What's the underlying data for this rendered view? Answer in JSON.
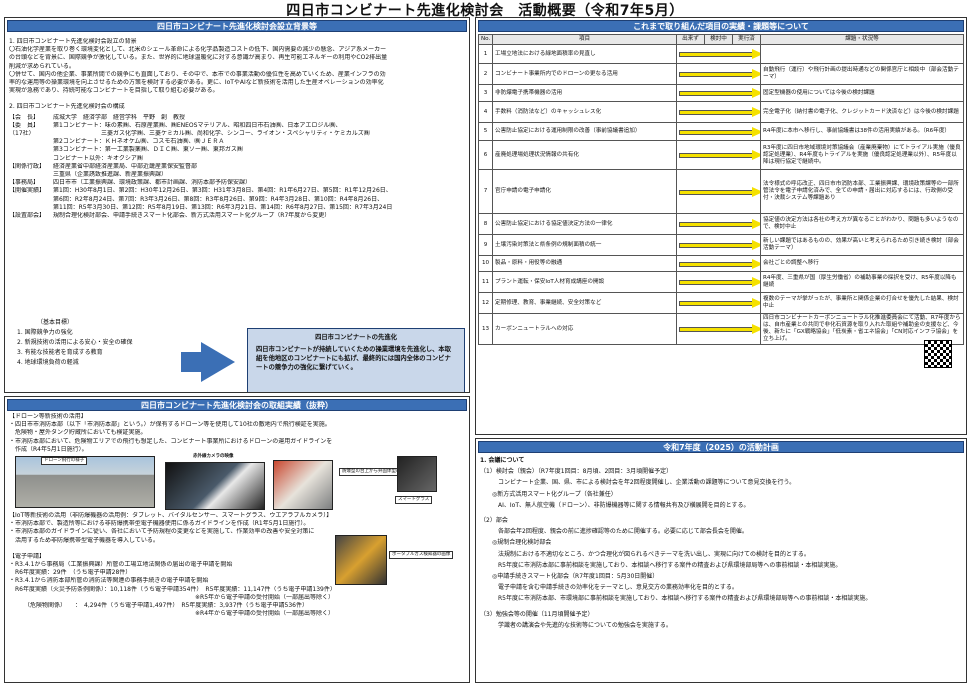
{
  "title": "四日市コンビナート先進化検討会　活動概要（令和7年5月）",
  "background": {
    "header": "四日市コンビナート先進化検討会設立背景等",
    "sec1_title": "1. 四日市コンビナート先進化検討会設立の背景",
    "sec1_lines": [
      "〇石油化学産業を取り巻く環境変化として、北米のシェール革命による化学品製造コストの低下、国内需要の減少の懸念、アジア系メーカー",
      "の台頭などを背景に、国際競争が激化している。また、世界的に地球温暖化に対する意識が高まり、再生可能エネルギーの利用やCO2排出量",
      "削減が求められている。",
      "〇併せて、国内の他企業、事業所間での競争にも直面しており、その中で、本市での事業活動の優位性を高めていくため、産業インフラの効",
      "率的な運用等の操業環境を向上させるための方策を検討する必要がある。更に、IoTやAIなど新技術を活用した生産オペレーションの効率化",
      "実現が急務であり、持続可能なコンビナートを目指して取り組む必要がある。"
    ],
    "sec2_title": "2. 四日市コンビナート先進化検討会の構成",
    "members": [
      {
        "k": "【会　長】",
        "v": "成城大学　経済学部　経営学科　平野　創　教授"
      },
      {
        "k": "【委　員】",
        "v": "第1コンビナート：味の素㈱、石原産業㈱、㈱ENEOSマテリアル、昭和四日市石油㈱、日本アエロジル㈱、"
      },
      {
        "k": "（17社）",
        "v": "　　　　　　　　三菱ガス化学㈱、三菱ケミカル㈱、尚和化学、シンコー、ライオン・スペシャリティ・ケミカルズ㈱"
      },
      {
        "k": "",
        "v": "第2コンビナート：ＫＨネオケム㈱、コスモ石油㈱、㈱ＪＥＲＡ"
      },
      {
        "k": "",
        "v": "第3コンビナート：第一工業製薬㈱、ＤＩＣ㈱、東ソー㈱、東邦ガス㈱"
      },
      {
        "k": "",
        "v": "コンビナート以外：キオクシア㈱"
      },
      {
        "k": "【関係行政】",
        "v": "経済産業省中部経済産業局、中部近畿産業保安監督部"
      },
      {
        "k": "",
        "v": "三重県（企業誘致推進課、新産業振興課）"
      },
      {
        "k": "【事務局】",
        "v": "四日市市（工業振興課、環境政策課、都市計画課、消防本部予防保安課）"
      },
      {
        "k": "【開催実績】",
        "v": "第1回：H30年8月1日、第2回：H30年12月26日、第3回：H31年3月8日、第4回：R1年6月27日、第5回：R1年12月26日、"
      },
      {
        "k": "",
        "v": "第6回：R2年8月24日、第7回：R3年3月26日、第8回：R3年8月26日、第9回：R4年3月28日、第10回：R4年8月26日、"
      },
      {
        "k": "",
        "v": "第11回：R5年3月30日、第12回：R5年8月19日、第13回：R6年3月21日、第14回：R6年8月27日、第15回：R7年3月24日"
      },
      {
        "k": "【設置部会】",
        "v": "規制合理化検討部会、申請手続きスマート化部会、新方式活用スマート化グループ（R7年度から変更）"
      }
    ],
    "basic_title": "（基本目標）",
    "basic_goals": [
      "1. 国際競争力の強化",
      "2. 新規技術の活用による安心・安全の確保",
      "3. 有能な技能者を育成する教育",
      "4. 地球環境負荷の軽減"
    ],
    "goal_box": {
      "title": "四日市コンビナートの先進化",
      "body": "四日市コンビナートが持続していくための操業環境を先進化し、本取組を他地区のコンビナートにも拡げ、最終的には国内全体のコンビナートの競争力の強化に繋げていく。"
    }
  },
  "efforts": {
    "header": "四日市コンビナート先進化検討会の取組実績（抜粋）",
    "drone_title": "【ドローン等新技術の活用】",
    "drone_lines": [
      "・四日市市消防本部（以下「市消防本部」という。）が保有するドローン等を使用して10社の敷地内で飛行検証を実施。",
      "　危険物・屋外タンク貯蔵所においても検証実施。",
      "・市消防本部において、危険物エリアでの飛行も想定した、コンビナート事業所におけるドローンの運用ガイドラインを",
      "　作成（R4年5月1日施行）。"
    ],
    "photo_labels": [
      "ドローン飛行の様子",
      "赤外線カメラの映像",
      "スマートグラス",
      "防爆型の台上から弁固体型のタブレット片",
      "ポータブルガス検知器の画像"
    ],
    "iot_title": "【IoT等新技術の活用（非防爆機器の活用例：タブレット、バイタルセンサー、スマートグラス、ウエアラブルカメラ）】",
    "iot_lines": [
      "・市消防本部で、製造所等における非防爆携帯型電子機器使用に係るガイドラインを作成（R1年5月1日施行）。",
      "・市消防本部のガイドラインに従い、各社において予防規程の変更などを実施して、作業効率の改善や安全対策に",
      "　活用するため非防爆携帯型電子機器を導入している。"
    ],
    "e_title": "【電子申請】",
    "e_lines": [
      "・R3.4.1から事務局（工業振興課）所管の工場立地法関係の届出の電子申請を開始",
      "　R6年度実績：29件　（うち電子申請28件）",
      "・R3.4.1から消防本部所管の消防法等関連の事務手続きの電子申請を開始",
      "　R6年度実績（火災予防条例関係）：10,118件（うち電子申請354件）　R5年度実績：11,147件（うち電子申請139件）",
      "　　　　　　　　　　　　　　　　　　　　　　　　　　　　　　　※R5年から電子申請の受付開始（一部届出等除く）",
      "　　　（危険物関係）　　：　4,294件（うち電子申請1,497件）　R5年度実績：3,937件（うち電子申請536件）",
      "　　　　　　　　　　　　　　　　　　　　　　　　　　　　　　　※R4年から電子申請の受付開始（一部届出等除く）"
    ]
  },
  "table": {
    "header": "これまで取り組んだ項目の実績・課題等について",
    "cols": [
      "No.",
      "項目",
      "出来ず",
      "検討中",
      "実行済",
      "課題・状況等"
    ],
    "rows": [
      {
        "no": "1",
        "item": "工場立地法における緑地面積率の見直し",
        "note": ""
      },
      {
        "no": "2",
        "item": "コンビナート事業所内でのドローンの更なる活用",
        "note": "自動飛行（運行）や飛行計画の提出時通などの関係官庁と相談中（部会活動テーマ）"
      },
      {
        "no": "3",
        "item": "非防爆電子携帯機器の活用",
        "note": "固定型機器の使用については今後の検討課題"
      },
      {
        "no": "4",
        "item": "手数料（消防法など）のキャッシュレス化",
        "note": "完全電子化（納付書の電子化、クレジットカード決済など）は今後の検討課題"
      },
      {
        "no": "5",
        "item": "公害防止協定における運用制限の改善（事前協議書追加）",
        "note": "R4年度に本市へ移行し、事前協議書は38件の活用実績がある。（R6年度）"
      },
      {
        "no": "6",
        "item": "産廃処理場処理状況情報の共有化",
        "note": "R3年度に四日市地域環境対策協議会（産業廃棄物）にてトライアル実施（優良認定処理業）、R4年度もトライアルを実施（優良認定処理業以外）、R5年度以降は現行協定で継続中。"
      },
      {
        "no": "7",
        "item": "官庁申請の電子申請化",
        "note": "法令様式の呼応改正、四日市市消防本部、工業振興課、環境政策課等の一部所管法令を電子申請化済みで、全ての申請・届出に対応するには、行政側の受付・決裁システム等課題あり"
      },
      {
        "no": "8",
        "item": "公害防止協定における協定値決定方法の一律化",
        "note": "協定値の決定方法は各社の考え方が異なることがわかり、問題も多いようなので、検討中止"
      },
      {
        "no": "9",
        "item": "土壌汚染対策法と県条例の規制面積の統一",
        "note": "新しい課題ではあるものの、効果が高いと考えられるため引き続き検討（部会活動テーマ）"
      },
      {
        "no": "10",
        "item": "製品・原料・用役等の融通",
        "note": "会社ごとの調整へ移行"
      },
      {
        "no": "11",
        "item": "プラント運転・保安IoT人材育成講座の開設",
        "note": "R4年度、三重県が国（厚生労働省）の補助事業の採択を受け、R5年度以降も継続"
      },
      {
        "no": "12",
        "item": "定期修理、教育、事業継続、安全対策など",
        "note": "複数のテーマが挙がったが、事業所と関係企業の打合せを優先した結果、検討中止"
      },
      {
        "no": "13",
        "item": "カーボンニュートラルへの対応",
        "note": "四日市コンビナートカーボンニュートラル化推進委員会にて活動、R7年度からは、自市産業との共同で非化石資源を取り入れた取組や補助金の支援など、今後、新たに「GX戦略協会」「低炭素・省エネ協会」「CN対応インフラ協会」を立ち上げ。"
      }
    ]
  },
  "plan": {
    "header": "令和7年度（2025）の活動計画",
    "lines": [
      "1. 会議について",
      "（1）検討会（親会）（R7年度1回目：8月頃、2回目：3月頃開催予定）",
      "　　　コンビナート企業、国、県、市による検討会を年2回程度開催し、企業活動の課題等について意見交換を行う。",
      "　　◎新方式活用スマート化グループ（各社兼任）",
      "　　　AI、IoT、無人航空機（ドローン）、非防爆機器等に関する情報共有及び横展開を目的とする。",
      "",
      "（2）部会",
      "　　　各部会年2回程度、親会の前に進捗確認等のために開催する。必要に応じて部会長会を開催。",
      "　　◎規制合理化検討部会",
      "　　　法規制における不適切なところ、かつ合理化が図られるべきテーマを洗い出し、実現に向けての検討を目的とする。",
      "　　　R5年度に市消防本部に事前相談を実施しており、本相談へ移行する案件の精査および県環境部局等への事前相談・本相談実施。",
      "　　◎申請手続きスマート化部会（R7年度1回目：5月30日開催）",
      "　　　電子申請を含む申請手続きの効率化をテーマとし、意見交方の業務効率化を目的とする。",
      "　　　R5年度に市消防本部、市環境部に事前相談を実施しており、本相談へ移行する案件の精査および県環境部局等への事前相談・本相談実施。",
      "",
      "（3）勉強会等の開催（11月頃開催予定）",
      "　　　学識者の講演会や先進的な技術等についての勉強会を実施する。"
    ]
  }
}
